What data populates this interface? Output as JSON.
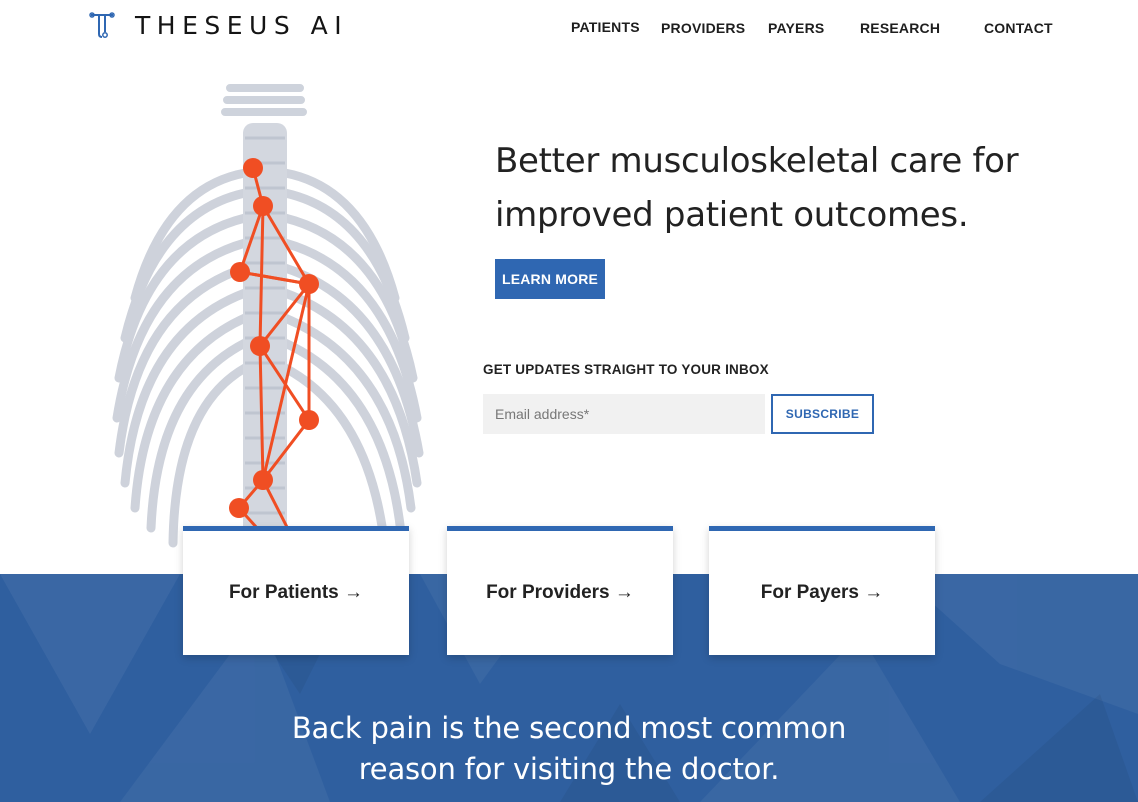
{
  "brand": {
    "name": "THESEUS AI"
  },
  "nav": {
    "items": [
      {
        "label": "PATIENTS"
      },
      {
        "label": "PROVIDERS"
      },
      {
        "label": "PAYERS"
      },
      {
        "label": "RESEARCH"
      },
      {
        "label": "CONTACT"
      }
    ]
  },
  "hero": {
    "headline_line1": "Better musculoskeletal care for",
    "headline_line2": "improved patient outcomes.",
    "cta_label": "LEARN MORE",
    "newsletter_label": "GET UPDATES STRAIGHT TO YOUR INBOX",
    "email_placeholder": "Email address*",
    "subscribe_label": "SUBSCRIBE"
  },
  "cards": [
    {
      "label": "For Patients →"
    },
    {
      "label": "For Providers →"
    },
    {
      "label": "For Payers →"
    }
  ],
  "band": {
    "line1": "Back pain is the second most common",
    "line2": "reason for visiting the doctor."
  },
  "colors": {
    "accent": "#2f67b2",
    "band": "#2f5f9f",
    "spine_overlay": "#f04e23",
    "skeleton": "#c9ced8"
  },
  "icons": {
    "logo": "theseus-logo-icon",
    "illustration": "spine-skeleton-illustration"
  }
}
